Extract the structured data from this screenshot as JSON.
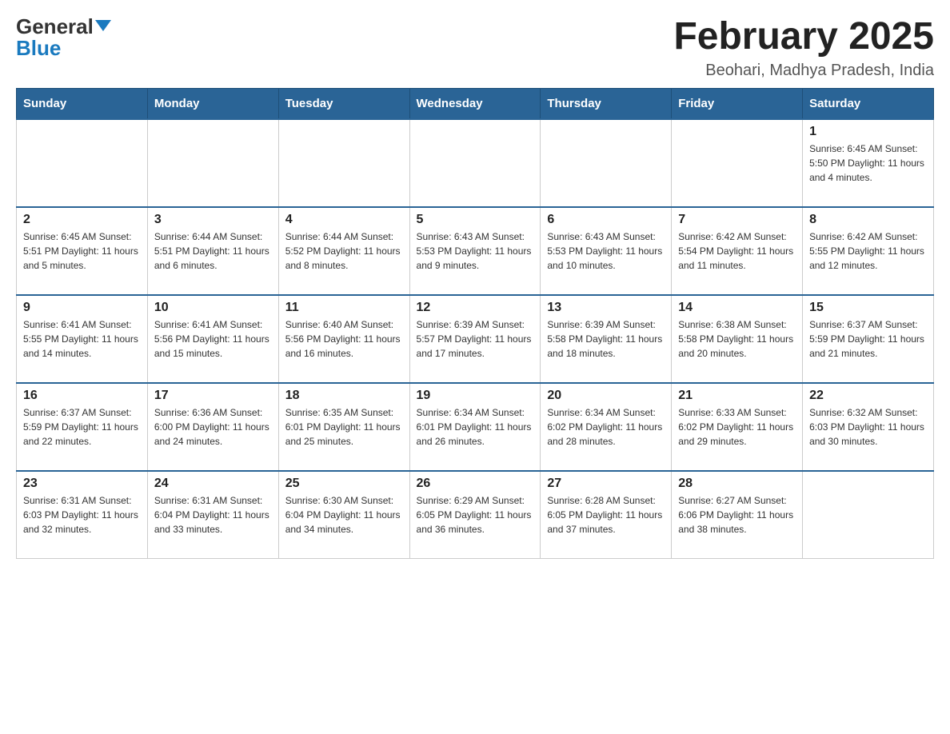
{
  "header": {
    "logo_general": "General",
    "logo_blue": "Blue",
    "calendar_title": "February 2025",
    "calendar_subtitle": "Beohari, Madhya Pradesh, India"
  },
  "weekdays": [
    "Sunday",
    "Monday",
    "Tuesday",
    "Wednesday",
    "Thursday",
    "Friday",
    "Saturday"
  ],
  "weeks": [
    [
      {
        "day": "",
        "info": ""
      },
      {
        "day": "",
        "info": ""
      },
      {
        "day": "",
        "info": ""
      },
      {
        "day": "",
        "info": ""
      },
      {
        "day": "",
        "info": ""
      },
      {
        "day": "",
        "info": ""
      },
      {
        "day": "1",
        "info": "Sunrise: 6:45 AM\nSunset: 5:50 PM\nDaylight: 11 hours and 4 minutes."
      }
    ],
    [
      {
        "day": "2",
        "info": "Sunrise: 6:45 AM\nSunset: 5:51 PM\nDaylight: 11 hours and 5 minutes."
      },
      {
        "day": "3",
        "info": "Sunrise: 6:44 AM\nSunset: 5:51 PM\nDaylight: 11 hours and 6 minutes."
      },
      {
        "day": "4",
        "info": "Sunrise: 6:44 AM\nSunset: 5:52 PM\nDaylight: 11 hours and 8 minutes."
      },
      {
        "day": "5",
        "info": "Sunrise: 6:43 AM\nSunset: 5:53 PM\nDaylight: 11 hours and 9 minutes."
      },
      {
        "day": "6",
        "info": "Sunrise: 6:43 AM\nSunset: 5:53 PM\nDaylight: 11 hours and 10 minutes."
      },
      {
        "day": "7",
        "info": "Sunrise: 6:42 AM\nSunset: 5:54 PM\nDaylight: 11 hours and 11 minutes."
      },
      {
        "day": "8",
        "info": "Sunrise: 6:42 AM\nSunset: 5:55 PM\nDaylight: 11 hours and 12 minutes."
      }
    ],
    [
      {
        "day": "9",
        "info": "Sunrise: 6:41 AM\nSunset: 5:55 PM\nDaylight: 11 hours and 14 minutes."
      },
      {
        "day": "10",
        "info": "Sunrise: 6:41 AM\nSunset: 5:56 PM\nDaylight: 11 hours and 15 minutes."
      },
      {
        "day": "11",
        "info": "Sunrise: 6:40 AM\nSunset: 5:56 PM\nDaylight: 11 hours and 16 minutes."
      },
      {
        "day": "12",
        "info": "Sunrise: 6:39 AM\nSunset: 5:57 PM\nDaylight: 11 hours and 17 minutes."
      },
      {
        "day": "13",
        "info": "Sunrise: 6:39 AM\nSunset: 5:58 PM\nDaylight: 11 hours and 18 minutes."
      },
      {
        "day": "14",
        "info": "Sunrise: 6:38 AM\nSunset: 5:58 PM\nDaylight: 11 hours and 20 minutes."
      },
      {
        "day": "15",
        "info": "Sunrise: 6:37 AM\nSunset: 5:59 PM\nDaylight: 11 hours and 21 minutes."
      }
    ],
    [
      {
        "day": "16",
        "info": "Sunrise: 6:37 AM\nSunset: 5:59 PM\nDaylight: 11 hours and 22 minutes."
      },
      {
        "day": "17",
        "info": "Sunrise: 6:36 AM\nSunset: 6:00 PM\nDaylight: 11 hours and 24 minutes."
      },
      {
        "day": "18",
        "info": "Sunrise: 6:35 AM\nSunset: 6:01 PM\nDaylight: 11 hours and 25 minutes."
      },
      {
        "day": "19",
        "info": "Sunrise: 6:34 AM\nSunset: 6:01 PM\nDaylight: 11 hours and 26 minutes."
      },
      {
        "day": "20",
        "info": "Sunrise: 6:34 AM\nSunset: 6:02 PM\nDaylight: 11 hours and 28 minutes."
      },
      {
        "day": "21",
        "info": "Sunrise: 6:33 AM\nSunset: 6:02 PM\nDaylight: 11 hours and 29 minutes."
      },
      {
        "day": "22",
        "info": "Sunrise: 6:32 AM\nSunset: 6:03 PM\nDaylight: 11 hours and 30 minutes."
      }
    ],
    [
      {
        "day": "23",
        "info": "Sunrise: 6:31 AM\nSunset: 6:03 PM\nDaylight: 11 hours and 32 minutes."
      },
      {
        "day": "24",
        "info": "Sunrise: 6:31 AM\nSunset: 6:04 PM\nDaylight: 11 hours and 33 minutes."
      },
      {
        "day": "25",
        "info": "Sunrise: 6:30 AM\nSunset: 6:04 PM\nDaylight: 11 hours and 34 minutes."
      },
      {
        "day": "26",
        "info": "Sunrise: 6:29 AM\nSunset: 6:05 PM\nDaylight: 11 hours and 36 minutes."
      },
      {
        "day": "27",
        "info": "Sunrise: 6:28 AM\nSunset: 6:05 PM\nDaylight: 11 hours and 37 minutes."
      },
      {
        "day": "28",
        "info": "Sunrise: 6:27 AM\nSunset: 6:06 PM\nDaylight: 11 hours and 38 minutes."
      },
      {
        "day": "",
        "info": ""
      }
    ]
  ]
}
